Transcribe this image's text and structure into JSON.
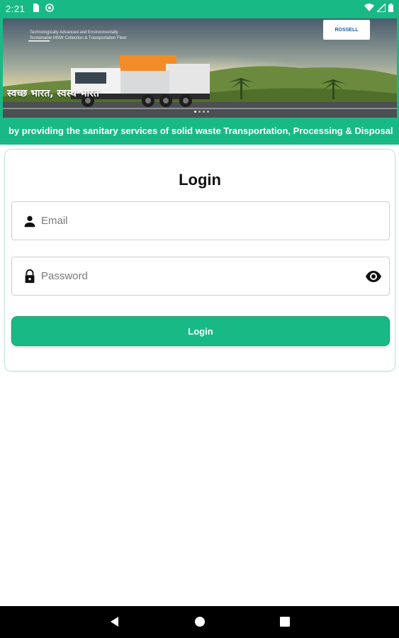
{
  "status_bar": {
    "time": "2:21",
    "icons_left": [
      "sim-card-icon",
      "vpn-icon"
    ],
    "icons_right": [
      "wifi-icon",
      "signal-icon",
      "battery-icon"
    ],
    "background_color": "#19b985"
  },
  "banner": {
    "hindi_text": "स्वच्छ भारत, स्वस्थ भारत",
    "tagline": "Technologically Advanced and Environmentally Sustainable MSW Collection & Transportation Fleet",
    "logo_text": "ROSSELL",
    "carousel_dots": 4,
    "carousel_active": 1
  },
  "marquee": {
    "text": "by providing the sanitary services of solid waste Transportation, Processing & Disposal"
  },
  "login": {
    "title": "Login",
    "email": {
      "placeholder": "Email",
      "value": "",
      "icon": "person-icon"
    },
    "password": {
      "placeholder": "Password",
      "value": "",
      "icon": "lock-icon",
      "toggle_icon": "eye-icon"
    },
    "button_label": "Login",
    "accent_color": "#19b985"
  },
  "nav_bar": {
    "buttons": [
      "back-icon",
      "home-icon",
      "recents-icon"
    ]
  }
}
